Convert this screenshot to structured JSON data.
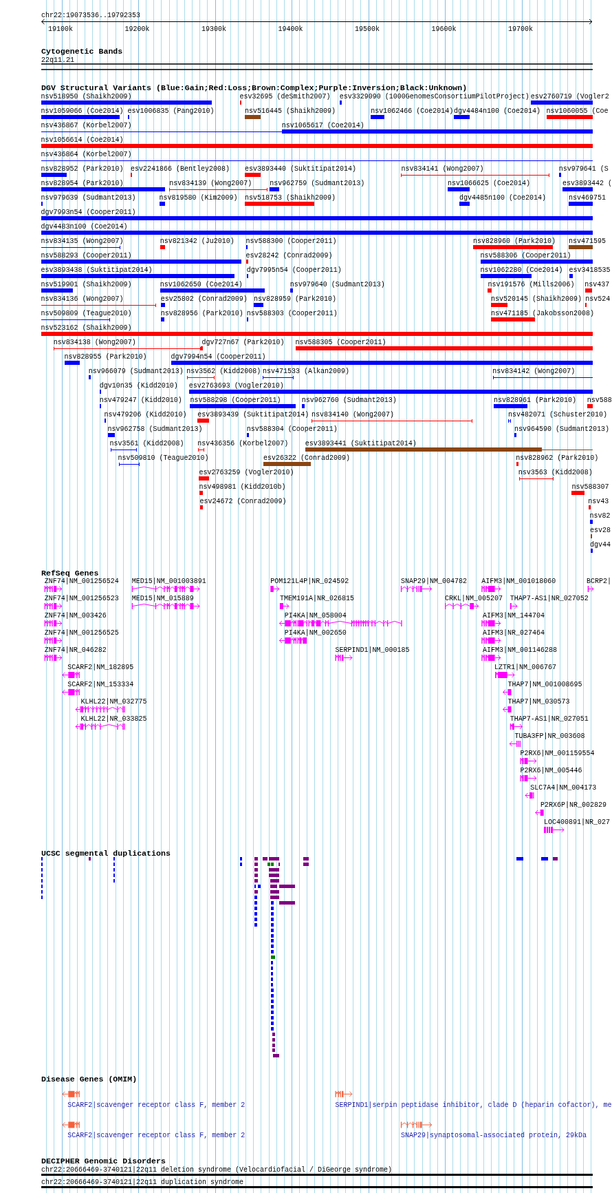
{
  "ruler": {
    "location": "chr22:19073536..19792353",
    "ticks": [
      "19100k",
      "19200k",
      "19300k",
      "19400k",
      "19500k",
      "19600k",
      "19700k"
    ]
  },
  "cytogenetic_bands": {
    "title": "Cytogenetic Bands",
    "band": "22q11.21"
  },
  "dgv": {
    "title": "DGV Structural Variants (Blue:Gain;Red:Loss;Brown:Complex;Purple:Inversion;Black:Unknown)",
    "rows": [
      [
        {
          "label": "nsv518950 (Shaikh2009)",
          "kind": "bar",
          "color": "#0000ff"
        },
        {
          "label": "esv32695 (deSmith2007)",
          "kind": "bar",
          "color": "#ff0000"
        },
        {
          "label": "esv3329090 (1000GenomesConsortiumPilotProject)",
          "kind": "bar",
          "color": "#0000ff"
        },
        {
          "label": "esv2760719 (Vogler2",
          "kind": "bar",
          "color": "#0000ff"
        }
      ],
      [
        {
          "label": "nsv1059066 (Coe2014)",
          "kind": "bar",
          "color": "#0000ff"
        },
        {
          "label": "esv1006835 (Pang2010)",
          "kind": "bar",
          "color": "#0000ff"
        },
        {
          "label": "nsv516445 (Shaikh2009)",
          "kind": "bar",
          "color": "#8b4513"
        },
        {
          "label": "nsv1062466 (Coe2014)",
          "kind": "bar",
          "color": "#0000ff"
        },
        {
          "label": "dgv4484n100 (Coe2014)",
          "kind": "bar",
          "color": "#0000ff"
        },
        {
          "label": "nsv1060055 (Coe",
          "kind": "bar",
          "color": "#ff0000"
        }
      ],
      [
        {
          "label": "nsv436867 (Korbel2007)",
          "kind": "span",
          "color": "#0000ff"
        },
        {
          "label": "nsv1065617 (Coe2014)",
          "kind": "bar",
          "color": "#0000ff"
        }
      ],
      [
        {
          "label": "nsv1056614 (Coe2014)",
          "kind": "bar",
          "color": "#ff0000"
        }
      ],
      [
        {
          "label": "nsv436864 (Korbel2007)",
          "kind": "span",
          "color": "#0000ff"
        }
      ],
      [
        {
          "label": "nsv828952 (Park2010)",
          "kind": "bar",
          "color": "#0000ff"
        },
        {
          "label": "esv2241866 (Bentley2008)",
          "kind": "bar",
          "color": "#ff0000"
        },
        {
          "label": "esv3893440 (Suktitipat2014)",
          "kind": "bar",
          "color": "#ff0000"
        },
        {
          "label": "nsv834141 (Wong2007)",
          "kind": "span",
          "color": "#ff0000"
        },
        {
          "label": "nsv979641 (S",
          "kind": "bar",
          "color": "#0000ff"
        }
      ],
      [
        {
          "label": "nsv828954 (Park2010)",
          "kind": "bar",
          "color": "#0000ff"
        },
        {
          "label": "nsv834139 (Wong2007)",
          "kind": "span",
          "color": "#ff0000"
        },
        {
          "label": "nsv962759 (Sudmant2013)",
          "kind": "bar",
          "color": "#0000ff"
        },
        {
          "label": "nsv1066625 (Coe2014)",
          "kind": "bar",
          "color": "#0000ff"
        },
        {
          "label": "esv3893442 (",
          "kind": "bar",
          "color": "#0000ff"
        }
      ],
      [
        {
          "label": "nsv979639 (Sudmant2013)",
          "kind": "bar",
          "color": "#0000ff"
        },
        {
          "label": "nsv819580 (Kim2009)",
          "kind": "bar",
          "color": "#0000ff"
        },
        {
          "label": "nsv518753 (Shaikh2009)",
          "kind": "bar",
          "color": "#ff0000"
        },
        {
          "label": "dgv4485n100 (Coe2014)",
          "kind": "bar",
          "color": "#0000ff"
        },
        {
          "label": "nsv469751",
          "kind": "bar",
          "color": "#0000ff"
        }
      ],
      [
        {
          "label": "dgv7993n54 (Cooper2011)",
          "kind": "bar",
          "color": "#0000ff"
        }
      ],
      [
        {
          "label": "dgv4483n100 (Coe2014)",
          "kind": "bar",
          "color": "#0000ff"
        }
      ],
      [
        {
          "label": "nsv834135 (Wong2007)",
          "kind": "span",
          "color": "#0000ff"
        },
        {
          "label": "nsv821342 (Ju2010)",
          "kind": "bar",
          "color": "#ff0000"
        },
        {
          "label": "nsv588300 (Cooper2011)",
          "kind": "bar",
          "color": "#0000ff"
        },
        {
          "label": "nsv828960 (Park2010)",
          "kind": "bar",
          "color": "#ff0000"
        },
        {
          "label": "nsv471595",
          "kind": "bar",
          "color": "#8b4513"
        }
      ],
      [
        {
          "label": "nsv588293 (Cooper2011)",
          "kind": "bar",
          "color": "#0000ff"
        },
        {
          "label": "esv28242 (Conrad2009)",
          "kind": "bar",
          "color": "#ff0000"
        },
        {
          "label": "nsv588306 (Cooper2011)",
          "kind": "bar",
          "color": "#0000ff"
        }
      ],
      [
        {
          "label": "esv3893438 (Suktitipat2014)",
          "kind": "bar",
          "color": "#0000ff"
        },
        {
          "label": "dgv7995n54 (Cooper2011)",
          "kind": "bar",
          "color": "#0000ff"
        },
        {
          "label": "nsv1062280 (Coe2014)",
          "kind": "bar",
          "color": "#0000ff"
        },
        {
          "label": "esv3418535",
          "kind": "bar",
          "color": "#0000ff"
        }
      ],
      [
        {
          "label": "nsv519901 (Shaikh2009)",
          "kind": "bar",
          "color": "#0000ff"
        },
        {
          "label": "nsv1062650 (Coe2014)",
          "kind": "bar",
          "color": "#0000ff"
        },
        {
          "label": "nsv979640 (Sudmant2013)",
          "kind": "bar",
          "color": "#0000ff"
        },
        {
          "label": "nsv191576 (Mills2006)",
          "kind": "bar",
          "color": "#ff0000"
        },
        {
          "label": "nsv437",
          "kind": "bar",
          "color": "#ff0000"
        }
      ],
      [
        {
          "label": "nsv834136 (Wong2007)",
          "kind": "span",
          "color": "#ff0000"
        },
        {
          "label": "esv25802 (Conrad2009)",
          "kind": "bar",
          "color": "#0000ff"
        },
        {
          "label": "nsv828959 (Park2010)",
          "kind": "bar",
          "color": "#0000ff"
        },
        {
          "label": "nsv520145 (Shaikh2009)",
          "kind": "bar",
          "color": "#ff0000"
        },
        {
          "label": "nsv524",
          "kind": "bar",
          "color": "#ff0000"
        }
      ],
      [
        {
          "label": "nsv509809 (Teague2010)",
          "kind": "span",
          "color": "#0000ff"
        },
        {
          "label": "nsv828956 (Park2010)",
          "kind": "bar",
          "color": "#0000ff"
        },
        {
          "label": "nsv588303 (Cooper2011)",
          "kind": "bar",
          "color": "#0000ff"
        },
        {
          "label": "nsv471185 (Jakobsson2008)",
          "kind": "bar",
          "color": "#ff0000"
        }
      ],
      [
        {
          "label": "nsv523162 (Shaikh2009)",
          "kind": "bar",
          "color": "#ff0000"
        }
      ],
      [
        {
          "label": "nsv834138 (Wong2007)",
          "kind": "span",
          "color": "#ff0000"
        },
        {
          "label": "dgv727n67 (Park2010)",
          "kind": "bar",
          "color": "#ff0000"
        },
        {
          "label": "nsv588305 (Cooper2011)",
          "kind": "bar",
          "color": "#ff0000"
        }
      ],
      [
        {
          "label": "nsv828955 (Park2010)",
          "kind": "bar",
          "color": "#0000ff"
        },
        {
          "label": "dgv7994n54 (Cooper2011)",
          "kind": "bar",
          "color": "#0000ff"
        }
      ],
      [
        {
          "label": "nsv966079 (Sudmant2013)",
          "kind": "bar",
          "color": "#0000ff"
        },
        {
          "label": "nsv3562 (Kidd2008)",
          "kind": "span",
          "color": "#ff0000"
        },
        {
          "label": "nsv471533 (Alkan2009)",
          "kind": "span",
          "color": "#0000ff"
        },
        {
          "label": "nsv834142 (Wong2007)",
          "kind": "span",
          "color": "#0000ff"
        }
      ],
      [
        {
          "label": "dgv10n35 (Kidd2010)",
          "kind": "bar",
          "color": "#0000ff"
        },
        {
          "label": "esv2763693 (Vogler2010)",
          "kind": "bar",
          "color": "#0000ff"
        }
      ],
      [
        {
          "label": "nsv479247 (Kidd2010)",
          "kind": "bar",
          "color": "#0000ff"
        },
        {
          "label": "nsv588298 (Cooper2011)",
          "kind": "bar",
          "color": "#0000ff"
        },
        {
          "label": "nsv962760 (Sudmant2013)",
          "kind": "bar",
          "color": "#0000ff"
        },
        {
          "label": "nsv828961 (Park2010)",
          "kind": "bar",
          "color": "#0000ff"
        },
        {
          "label": "nsv588",
          "kind": "bar",
          "color": "#ff0000"
        }
      ],
      [
        {
          "label": "nsv479206 (Kidd2010)",
          "kind": "bar",
          "color": "#0000ff"
        },
        {
          "label": "esv3893439 (Suktitipat2014)",
          "kind": "bar",
          "color": "#ff0000"
        },
        {
          "label": "nsv834140 (Wong2007)",
          "kind": "span",
          "color": "#ff0000"
        },
        {
          "label": "nsv482071 (Schuster2010)",
          "kind": "span",
          "color": "#0000ff"
        }
      ],
      [
        {
          "label": "nsv962758 (Sudmant2013)",
          "kind": "bar",
          "color": "#0000ff"
        },
        {
          "label": "nsv588304 (Cooper2011)",
          "kind": "bar",
          "color": "#0000ff"
        },
        {
          "label": "nsv964590 (Sudmant2013)",
          "kind": "bar",
          "color": "#0000ff"
        }
      ],
      [
        {
          "label": "nsv3561 (Kidd2008)",
          "kind": "span",
          "color": "#0000ff"
        },
        {
          "label": "nsv436356 (Korbel2007)",
          "kind": "span",
          "color": "#ff0000"
        },
        {
          "label": "esv3893441 (Suktitipat2014)",
          "kind": "bar",
          "color": "#8b4513"
        }
      ],
      [
        {
          "label": "nsv509810 (Teague2010)",
          "kind": "span",
          "color": "#0000ff"
        },
        {
          "label": "esv26322 (Conrad2009)",
          "kind": "bar",
          "color": "#8b4513"
        },
        {
          "label": "nsv828962 (Park2010)",
          "kind": "bar",
          "color": "#ff0000"
        }
      ],
      [
        {
          "label": "esv2763259 (Vogler2010)",
          "kind": "bar",
          "color": "#ff0000"
        },
        {
          "label": "nsv3563 (Kidd2008)",
          "kind": "span",
          "color": "#ff0000"
        }
      ],
      [
        {
          "label": "nsv498981 (Kidd2010b)",
          "kind": "bar",
          "color": "#ff0000"
        },
        {
          "label": "nsv588307",
          "kind": "bar",
          "color": "#ff0000"
        }
      ],
      [
        {
          "label": "esv24672 (Conrad2009)",
          "kind": "bar",
          "color": "#ff0000"
        },
        {
          "label": "nsv43",
          "kind": "bar",
          "color": "#ff0000"
        }
      ],
      [
        {
          "label": "nsv82",
          "kind": "bar",
          "color": "#0000ff"
        }
      ],
      [
        {
          "label": "esv28",
          "kind": "bar",
          "color": "#8b4513"
        }
      ],
      [
        {
          "label": "dgv44",
          "kind": "bar",
          "color": "#0000ff"
        }
      ]
    ]
  },
  "refseq": {
    "title": "RefSeq Genes",
    "rows": [
      [
        {
          "label": "ZNF74|NM_001256524",
          "kind": "forward"
        },
        {
          "label": "MED15|NM_001003891",
          "kind": "forward"
        },
        {
          "label": "POM121L4P|NR_024592",
          "kind": "forward"
        },
        {
          "label": "SNAP29|NM_004782",
          "kind": "forward"
        },
        {
          "label": "AIFM3|NM_001018060",
          "kind": "forward"
        },
        {
          "label": "BCRP2|",
          "kind": "forward"
        }
      ],
      [
        {
          "label": "ZNF74|NM_001256523",
          "kind": "forward"
        },
        {
          "label": "MED15|NM_015889",
          "kind": "forward"
        },
        {
          "label": "TMEM191A|NR_026815",
          "kind": "forward"
        },
        {
          "label": "CRKL|NM_005207",
          "kind": "forward"
        },
        {
          "label": "THAP7-AS1|NR_027052",
          "kind": "forward"
        }
      ],
      [
        {
          "label": "ZNF74|NM_003426",
          "kind": "forward"
        },
        {
          "label": "PI4KA|NM_058004",
          "kind": "reverse"
        },
        {
          "label": "AIFM3|NM_144704",
          "kind": "forward"
        }
      ],
      [
        {
          "label": "ZNF74|NM_001256525",
          "kind": "forward"
        },
        {
          "label": "PI4KA|NM_002650",
          "kind": "reverse"
        },
        {
          "label": "AIFM3|NR_027464",
          "kind": "forward"
        }
      ],
      [
        {
          "label": "ZNF74|NR_046282",
          "kind": "forward"
        },
        {
          "label": "SERPIND1|NM_000185",
          "kind": "forward"
        },
        {
          "label": "AIFM3|NM_001146288",
          "kind": "forward"
        }
      ],
      [
        {
          "label": "SCARF2|NM_182895",
          "kind": "reverse"
        },
        {
          "label": "LZTR1|NM_006767",
          "kind": "forward"
        }
      ],
      [
        {
          "label": "SCARF2|NM_153334",
          "kind": "reverse"
        },
        {
          "label": "THAP7|NM_001008695",
          "kind": "reverse"
        }
      ],
      [
        {
          "label": "KLHL22|NM_032775",
          "kind": "reverse"
        },
        {
          "label": "THAP7|NM_030573",
          "kind": "reverse"
        }
      ],
      [
        {
          "label": "KLHL22|NR_033825",
          "kind": "reverse"
        },
        {
          "label": "THAP7-AS1|NR_027051",
          "kind": "forward"
        }
      ],
      [
        {
          "label": "TUBA3FP|NR_003608",
          "kind": "reverse"
        }
      ],
      [
        {
          "label": "P2RX6|NM_001159554",
          "kind": "forward"
        }
      ],
      [
        {
          "label": "P2RX6|NM_005446",
          "kind": "forward"
        }
      ],
      [
        {
          "label": "SLC7A4|NM_004173",
          "kind": "reverse"
        }
      ],
      [
        {
          "label": "P2RX6P|NR_002829",
          "kind": "reverse"
        }
      ],
      [
        {
          "label": "LOC400891|NR_027",
          "kind": "forward"
        }
      ]
    ]
  },
  "segmental_duplications": {
    "title": "UCSC segmental duplications",
    "rows": [
      [
        {
          "color": "#0000ff"
        },
        {
          "color": "#800080"
        },
        {
          "color": "#0000ff"
        },
        {
          "color": "#0000ff"
        },
        {
          "color": "#800080"
        },
        {
          "color": "#800080"
        },
        {
          "color": "#800080"
        },
        {
          "color": "#800080"
        },
        {
          "color": "#0000ff"
        },
        {
          "color": "#0000ff"
        },
        {
          "color": "#800080"
        }
      ],
      [
        {
          "color": "#0000ff"
        },
        {
          "color": "#0000ff"
        },
        {
          "color": "#0000ff"
        },
        {
          "color": "#800080"
        },
        {
          "color": "#008000"
        },
        {
          "color": "#008000"
        },
        {
          "color": "#800080"
        },
        {
          "color": "#800080"
        }
      ],
      [
        {
          "color": "#0000ff"
        },
        {
          "color": "#0000ff"
        },
        {
          "color": "#800080"
        },
        {
          "color": "#800080"
        }
      ],
      [
        {
          "color": "#0000ff"
        },
        {
          "color": "#0000ff"
        },
        {
          "color": "#800080"
        },
        {
          "color": "#800080"
        }
      ],
      [
        {
          "color": "#0000ff"
        },
        {
          "color": "#0000ff"
        },
        {
          "color": "#800080"
        },
        {
          "color": "#800080"
        }
      ],
      [
        {
          "color": "#0000ff"
        },
        {
          "color": "#0000ff"
        },
        {
          "color": "#0000ff"
        },
        {
          "color": "#800080"
        },
        {
          "color": "#800080"
        }
      ],
      [
        {
          "color": "#0000ff"
        },
        {
          "color": "#800080"
        },
        {
          "color": "#800080"
        }
      ],
      [
        {
          "color": "#0000ff"
        },
        {
          "color": "#0000ff"
        },
        {
          "color": "#800080"
        }
      ],
      [
        {
          "color": "#0000ff"
        },
        {
          "color": "#0000ff"
        },
        {
          "color": "#800080"
        }
      ],
      [
        {
          "color": "#0000ff"
        },
        {
          "color": "#0000ff"
        }
      ],
      [
        {
          "color": "#0000ff"
        },
        {
          "color": "#0000ff"
        }
      ],
      [
        {
          "color": "#0000ff"
        },
        {
          "color": "#0000ff"
        }
      ],
      [
        {
          "color": "#0000ff"
        },
        {
          "color": "#0000ff"
        }
      ],
      [
        {
          "color": "#0000ff"
        }
      ],
      [
        {
          "color": "#0000ff"
        }
      ],
      [
        {
          "color": "#0000ff"
        }
      ],
      [
        {
          "color": "#0000ff"
        }
      ],
      [
        {
          "color": "#0000ff"
        }
      ],
      [
        {
          "color": "#008000"
        },
        {
          "color": "#008000"
        }
      ],
      [
        {
          "color": "#0000ff"
        }
      ],
      [
        {
          "color": "#0000ff"
        }
      ],
      [
        {
          "color": "#0000ff"
        }
      ],
      [
        {
          "color": "#0000ff"
        }
      ],
      [
        {
          "color": "#0000ff"
        }
      ],
      [
        {
          "color": "#0000ff"
        }
      ],
      [
        {
          "color": "#0000ff"
        }
      ],
      [
        {
          "color": "#0000ff"
        }
      ],
      [
        {
          "color": "#0000ff"
        }
      ],
      [
        {
          "color": "#0000ff"
        }
      ],
      [
        {
          "color": "#0000ff"
        }
      ],
      [
        {
          "color": "#0000ff"
        }
      ],
      [
        {
          "color": "#0000ff"
        }
      ],
      [
        {
          "color": "#800080"
        }
      ],
      [
        {
          "color": "#800080"
        }
      ],
      [
        {
          "color": "#800080"
        }
      ],
      [
        {
          "color": "#800080"
        }
      ],
      [
        {
          "color": "#800080"
        }
      ]
    ]
  },
  "disease_genes": {
    "title": "Disease Genes (OMIM)",
    "rows": [
      [
        {
          "label": "SCARF2|scavenger receptor class F, member 2",
          "kind": "reverse"
        },
        {
          "label": "SERPIND1|serpin peptidase inhibitor, clade D (heparin cofactor), me",
          "kind": "forward"
        }
      ],
      [
        {
          "label": "SCARF2|scavenger receptor class F, member 2",
          "kind": "reverse"
        },
        {
          "label": "SNAP29|synaptosomal-associated protein, 29kDa",
          "kind": "forward"
        }
      ]
    ]
  },
  "decipher": {
    "title": "DECIPHER Genomic Disorders",
    "items": [
      {
        "label": "chr22:20666469-3740121|22q11 deletion syndrome (Velocardiofacial / DiGeorge syndrome)"
      },
      {
        "label": "chr22:20666469-3740121|22q11 duplication syndrome"
      }
    ]
  }
}
